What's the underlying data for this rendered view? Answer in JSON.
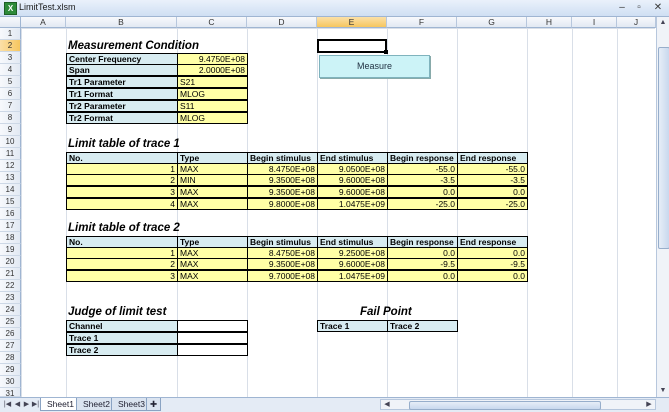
{
  "window": {
    "title": "LimitTest.xlsm",
    "minimize": "–",
    "restore": "▫",
    "close": "✕"
  },
  "columns": [
    "A",
    "B",
    "C",
    "D",
    "E",
    "F",
    "G",
    "H",
    "I",
    "J"
  ],
  "rows": [
    "1",
    "2",
    "3",
    "4",
    "5",
    "6",
    "7",
    "8",
    "9",
    "10",
    "11",
    "12",
    "13",
    "14",
    "15",
    "16",
    "17",
    "18",
    "19",
    "20",
    "21",
    "22",
    "23",
    "24",
    "25",
    "26",
    "27",
    "28",
    "29",
    "30",
    "31"
  ],
  "selected_cell": {
    "column": "E",
    "row": "2"
  },
  "measurement": {
    "heading": "Measurement Condition",
    "center_frequency_label": "Center Frequency",
    "center_frequency": "9.4750E+08",
    "span_label": "Span",
    "span": "2.0000E+08",
    "tr1_param_label": "Tr1 Parameter",
    "tr1_param": "S21",
    "tr1_format_label": "Tr1 Format",
    "tr1_format": "MLOG",
    "tr2_param_label": "Tr2 Parameter",
    "tr2_param": "S11",
    "tr2_format_label": "Tr2 Format",
    "tr2_format": "MLOG"
  },
  "measure_button": "Measure",
  "headers": {
    "no": "No.",
    "type": "Type",
    "begin_stimulus": "Begin stimulus",
    "end_stimulus": "End stimulus",
    "begin_response": "Begin response",
    "end_response": "End response"
  },
  "trace1": {
    "heading": "Limit table of trace 1",
    "rows": [
      {
        "no": "1",
        "type": "MAX",
        "bs": "8.4750E+08",
        "es": "9.0500E+08",
        "br": "-55.0",
        "er": "-55.0"
      },
      {
        "no": "2",
        "type": "MIN",
        "bs": "9.3500E+08",
        "es": "9.6000E+08",
        "br": "-3.5",
        "er": "-3.5"
      },
      {
        "no": "3",
        "type": "MAX",
        "bs": "9.3500E+08",
        "es": "9.6000E+08",
        "br": "0.0",
        "er": "0.0"
      },
      {
        "no": "4",
        "type": "MAX",
        "bs": "9.8000E+08",
        "es": "1.0475E+09",
        "br": "-25.0",
        "er": "-25.0"
      }
    ]
  },
  "trace2": {
    "heading": "Limit table of trace 2",
    "rows": [
      {
        "no": "1",
        "type": "MAX",
        "bs": "8.4750E+08",
        "es": "9.2500E+08",
        "br": "0.0",
        "er": "0.0"
      },
      {
        "no": "2",
        "type": "MAX",
        "bs": "9.3500E+08",
        "es": "9.6000E+08",
        "br": "-9.5",
        "er": "-9.5"
      },
      {
        "no": "3",
        "type": "MAX",
        "bs": "9.7000E+08",
        "es": "1.0475E+09",
        "br": "0.0",
        "er": "0.0"
      }
    ]
  },
  "judge": {
    "heading": "Judge of limit test",
    "channel": "Channel",
    "trace1": "Trace 1",
    "trace2": "Trace 2"
  },
  "fail_point": {
    "heading": "Fail Point",
    "trace1": "Trace 1",
    "trace2": "Trace 2"
  },
  "sheets": {
    "tab1": "Sheet1",
    "tab2": "Sheet2",
    "tab3": "Sheet3",
    "insert_icon": "insert-sheet-icon"
  }
}
